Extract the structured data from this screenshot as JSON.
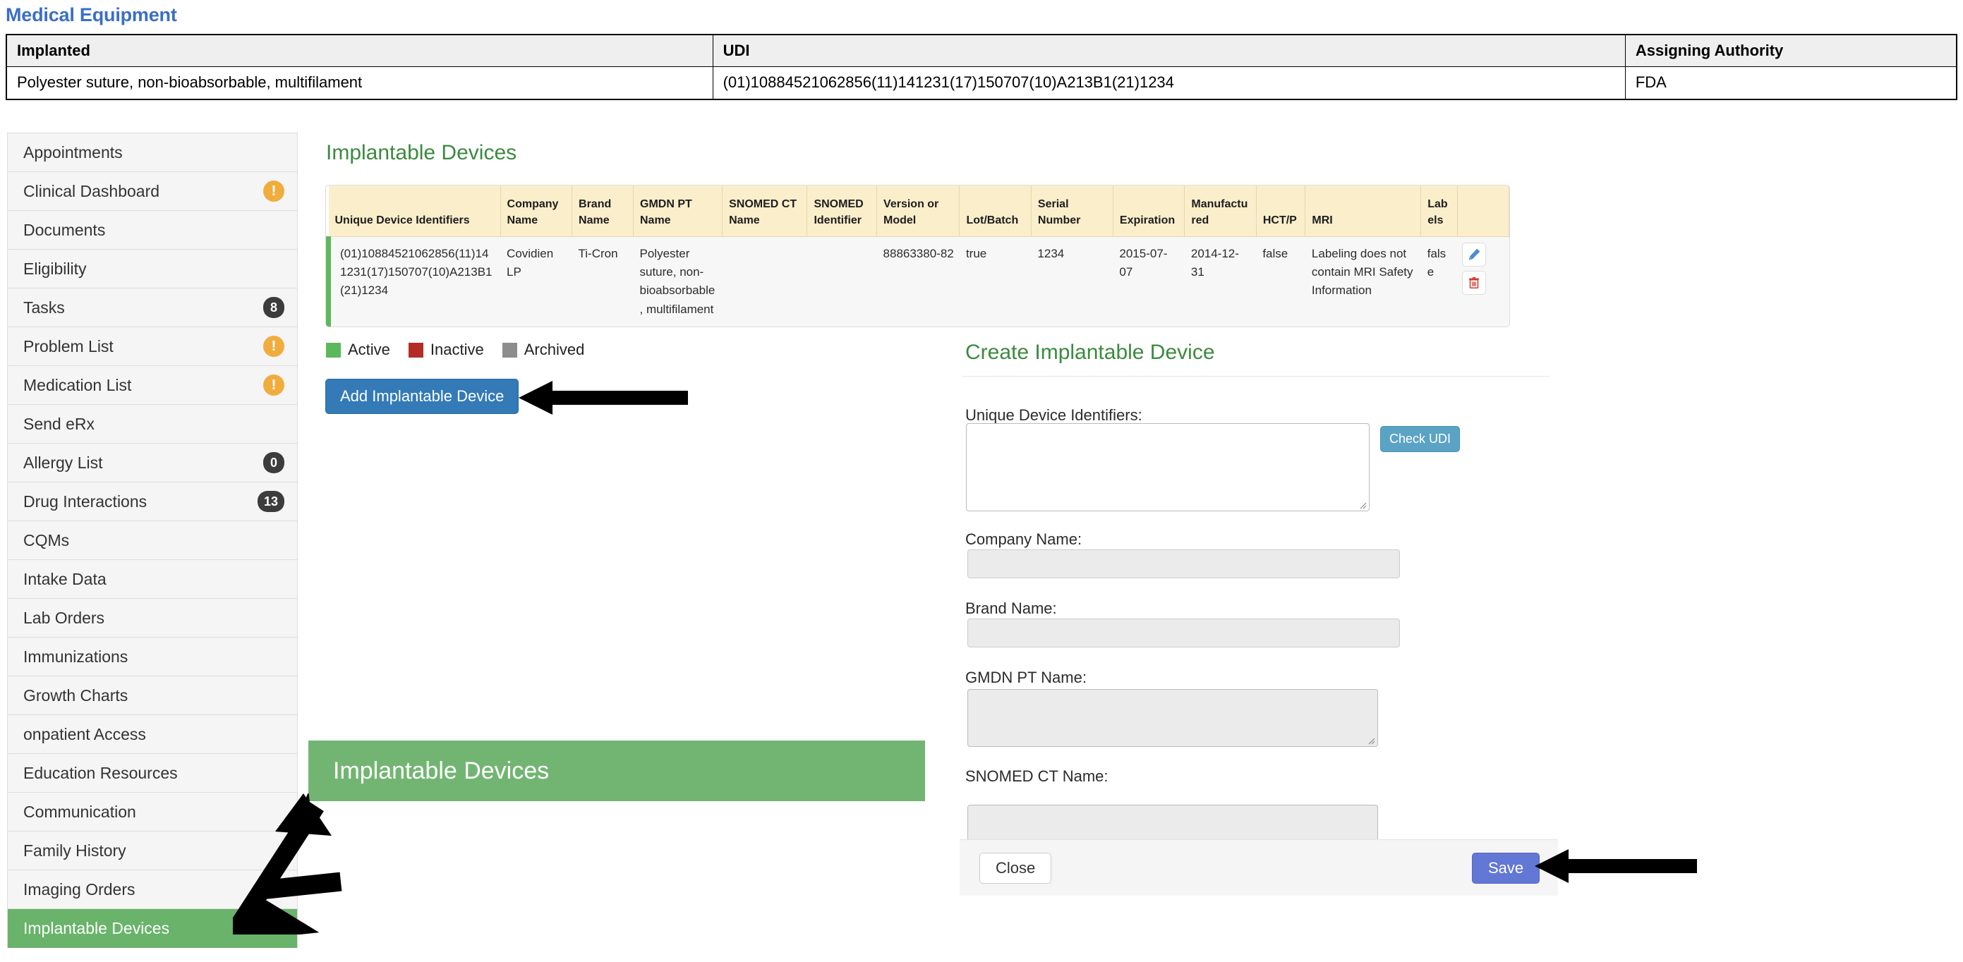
{
  "page": {
    "title": "Medical Equipment"
  },
  "equipment_table": {
    "headers": [
      "Implanted",
      "UDI",
      "Assigning Authority"
    ],
    "rows": [
      {
        "implanted": "Polyester suture, non-bioabsorbable, multifilament",
        "udi": "(01)10884521062856(11)141231(17)150707(10)A213B1(21)1234",
        "authority": "FDA"
      }
    ]
  },
  "sidebar": {
    "items": [
      {
        "label": "Appointments",
        "badge": null,
        "badge_type": null,
        "active": false
      },
      {
        "label": "Clinical Dashboard",
        "badge": "!",
        "badge_type": "warn",
        "active": false
      },
      {
        "label": "Documents",
        "badge": null,
        "badge_type": null,
        "active": false
      },
      {
        "label": "Eligibility",
        "badge": null,
        "badge_type": null,
        "active": false
      },
      {
        "label": "Tasks",
        "badge": "8",
        "badge_type": "num",
        "active": false
      },
      {
        "label": "Problem List",
        "badge": "!",
        "badge_type": "warn",
        "active": false
      },
      {
        "label": "Medication List",
        "badge": "!",
        "badge_type": "warn",
        "active": false
      },
      {
        "label": "Send eRx",
        "badge": null,
        "badge_type": null,
        "active": false
      },
      {
        "label": "Allergy List",
        "badge": "0",
        "badge_type": "num",
        "active": false
      },
      {
        "label": "Drug Interactions",
        "badge": "13",
        "badge_type": "num",
        "active": false
      },
      {
        "label": "CQMs",
        "badge": null,
        "badge_type": null,
        "active": false
      },
      {
        "label": "Intake Data",
        "badge": null,
        "badge_type": null,
        "active": false
      },
      {
        "label": "Lab Orders",
        "badge": null,
        "badge_type": null,
        "active": false
      },
      {
        "label": "Immunizations",
        "badge": null,
        "badge_type": null,
        "active": false
      },
      {
        "label": "Growth Charts",
        "badge": null,
        "badge_type": null,
        "active": false
      },
      {
        "label": "onpatient Access",
        "badge": null,
        "badge_type": null,
        "active": false
      },
      {
        "label": "Education Resources",
        "badge": null,
        "badge_type": null,
        "active": false
      },
      {
        "label": "Communication",
        "badge": null,
        "badge_type": null,
        "active": false
      },
      {
        "label": "Family History",
        "badge": null,
        "badge_type": null,
        "active": false
      },
      {
        "label": "Imaging Orders",
        "badge": null,
        "badge_type": null,
        "active": false
      },
      {
        "label": "Implantable Devices",
        "badge": null,
        "badge_type": null,
        "active": true
      }
    ]
  },
  "main": {
    "heading": "Implantable Devices",
    "devices_table": {
      "headers": [
        "Unique Device Identifiers",
        "Company Name",
        "Brand Name",
        "GMDN PT Name",
        "SNOMED CT Name",
        "SNOMED Identifier",
        "Version or Model",
        "Lot/Batch",
        "Serial Number",
        "Expiration",
        "Manufactured",
        "HCT/P",
        "MRI",
        "Labels",
        ""
      ],
      "rows": [
        {
          "udi": "(01)10884521062856(11)141231(17)150707(10)A213B1(21)1234",
          "company_name": "Covidien LP",
          "brand_name": "Ti-Cron",
          "gmdn_pt_name": "Polyester suture, non-bioabsorbable, multifilament",
          "snomed_ct_name": "",
          "snomed_identifier": "",
          "version_or_model": "88863380-82",
          "lot_batch": "true",
          "serial_number": "1234",
          "expiration": "2015-07-07",
          "manufactured": "2014-12-31",
          "hct_p": "false",
          "mri": "Labeling does not contain MRI Safety Information",
          "labels": "false",
          "status": "active"
        }
      ]
    },
    "legend": [
      {
        "label": "Active",
        "color": "#5cb85c"
      },
      {
        "label": "Inactive",
        "color": "#b52b27"
      },
      {
        "label": "Archived",
        "color": "#8d8d8d"
      }
    ],
    "add_button": "Add Implantable Device",
    "green_banner": "Implantable Devices"
  },
  "create_form": {
    "title": "Create Implantable Device",
    "check_udi_button": "Check UDI",
    "fields": [
      {
        "label": "Unique Device Identifiers:",
        "value": "",
        "type": "textarea"
      },
      {
        "label": "Company Name:",
        "value": "",
        "type": "input"
      },
      {
        "label": "Brand Name:",
        "value": "",
        "type": "input"
      },
      {
        "label": "GMDN PT Name:",
        "value": "",
        "type": "textarea"
      },
      {
        "label": "SNOMED CT Name:",
        "value": "",
        "type": "textarea"
      }
    ],
    "footer": {
      "close_label": "Close",
      "save_label": "Save"
    }
  },
  "colors": {
    "title_blue": "#3b6fc4",
    "green_accent": "#3c8a3f",
    "active_green": "#69b36a",
    "primary_blue": "#337ab7",
    "save_blue": "#6377d4",
    "check_blue": "#5ba3c4",
    "warn_amber": "#f0ad3e",
    "table_header_cream": "#fbeecb"
  }
}
